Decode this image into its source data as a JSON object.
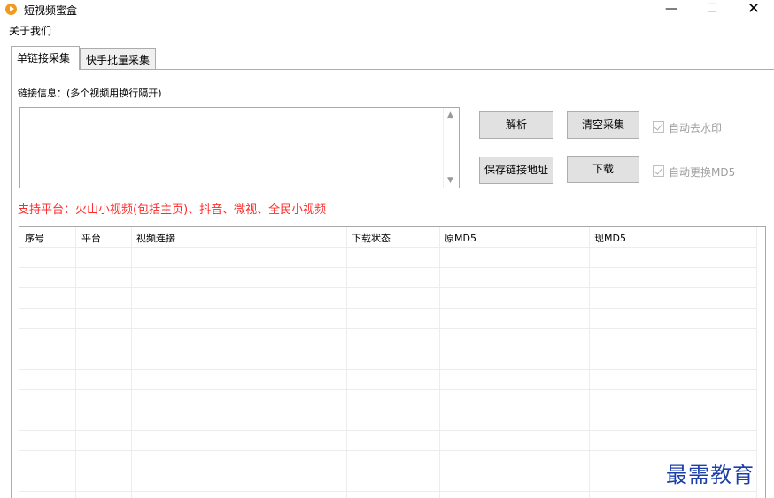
{
  "window": {
    "title": "短视频蜜盒",
    "minimize_glyph": "—",
    "maximize_glyph": "☐",
    "close_glyph": "✕"
  },
  "menu": {
    "about": "关于我们"
  },
  "tabs": [
    {
      "label": "单链接采集",
      "active": true
    },
    {
      "label": "快手批量采集",
      "active": false
    }
  ],
  "form": {
    "link_label": "链接信息：(多个视频用换行隔开)",
    "link_value": "",
    "scroll_up": "▲",
    "scroll_down": "▼"
  },
  "buttons": {
    "parse": "解析",
    "clear": "清空采集",
    "save_links": "保存链接地址",
    "download": "下载"
  },
  "options": {
    "auto_watermark": "自动去水印",
    "auto_md5": "自动更换MD5"
  },
  "platform_note": "支持平台：火山小视频(包括主页)、抖音、微视、全民小视频",
  "table": {
    "columns": [
      "序号",
      "平台",
      "视频连接",
      "下载状态",
      "原MD5",
      "现MD5"
    ]
  },
  "watermark": "最需教育",
  "colors": {
    "note_red": "#ff2b2b",
    "watermark_blue": "#1b3fa8",
    "app_icon": "#f29a1d"
  }
}
